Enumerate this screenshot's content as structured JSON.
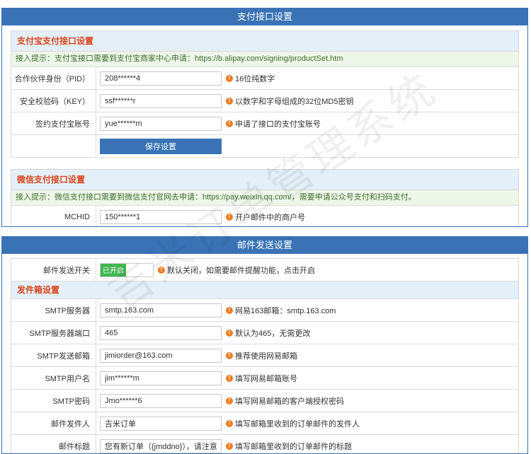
{
  "payment": {
    "header": "支付接口设置",
    "alipay": {
      "title": "支付宝支付接口设置",
      "tip": "接入提示：支付宝接口需要到支付宝商家中心申请：https://b.alipay.com/signing/productSet.htm",
      "rows": [
        {
          "label": "合作伙伴身份（PID）",
          "value": "208******4",
          "hint": "16位纯数字"
        },
        {
          "label": "安全校验码（KEY）",
          "value": "ssf******r",
          "hint": "以数字和字母组成的32位MD5密钥"
        },
        {
          "label": "签约支付宝账号",
          "value": "yue******m",
          "hint": "申请了接口的支付宝账号"
        }
      ],
      "save_label": "保存设置"
    },
    "wechat": {
      "title": "微信支付接口设置",
      "tip": "接入提示：微信支付接口需要到微信支付官网去申请：https://pay.weixin.qq.com/，需要申请公众号支付和扫码支付。",
      "rows": [
        {
          "label": "MCHID",
          "value": "150******1",
          "hint": "开户邮件中的商户号"
        }
      ]
    }
  },
  "mail": {
    "header": "邮件发送设置",
    "switch": {
      "label": "邮件发送开关",
      "on_text": "已开启",
      "hint": "默认关闭，如需要邮件提醒功能，点击开启"
    },
    "outbox": {
      "title": "发件箱设置",
      "rows": [
        {
          "label": "SMTP服务器",
          "value": "smtp.163.com",
          "hint": "网易163邮箱：smtp.163.com"
        },
        {
          "label": "SMTP服务器端口",
          "value": "465",
          "hint": "默认为465，无需更改"
        },
        {
          "label": "SMTP发送邮箱",
          "value": "jimiorder@163.com",
          "hint": "推荐使用网易邮箱"
        },
        {
          "label": "SMTP用户名",
          "value": "jim******m",
          "hint": "填写网易邮箱账号"
        },
        {
          "label": "SMTP密码",
          "value": "Jmo******6",
          "hint": "填写网易邮箱的客户端授权密码"
        },
        {
          "label": "邮件发件人",
          "value": "吉米订单",
          "hint": "填写邮箱里收到的订单邮件的发件人"
        },
        {
          "label": "邮件标题",
          "value": "您有新订单（{jmddno}），请注意查收！",
          "hint": "填写邮箱里收到的订单邮件的标题"
        }
      ]
    }
  },
  "watermark": "吉米订单管理系统",
  "icons": {
    "hint": "info-dot-icon"
  },
  "colors": {
    "accent": "#3a73b5",
    "section_title": "#d9451c",
    "switch_on": "#3fb650",
    "hint_dot": "#f07a20"
  }
}
